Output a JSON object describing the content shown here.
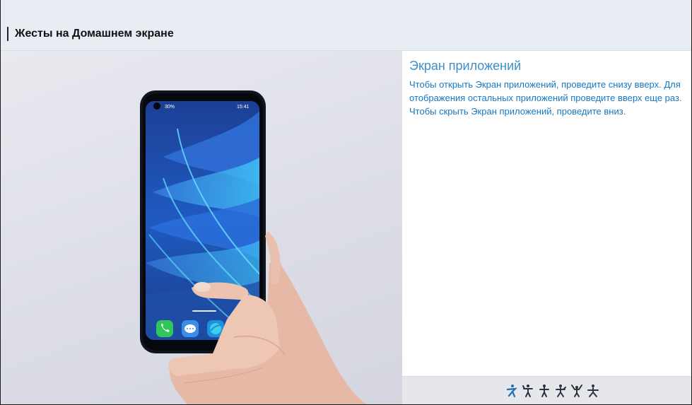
{
  "header": {
    "title": "Жесты на Домашнем экране"
  },
  "panel": {
    "title": "Экран приложений",
    "description": "Чтобы открыть Экран приложений, проведите снизу вверх. Для отображения остальных приложений проведите вверх еще раз. Чтобы скрыть Экран приложений, проведите вниз."
  },
  "phone": {
    "battery": "30%",
    "time": "15:41",
    "dock_apps": [
      "phone-app-icon",
      "messages-app-icon",
      "browser-app-icon",
      "camera-app-icon"
    ]
  },
  "gestures": {
    "active_index": 0,
    "icons": [
      "gesture-1-icon",
      "gesture-2-icon",
      "gesture-3-icon",
      "gesture-4-icon",
      "gesture-5-icon",
      "gesture-6-icon"
    ]
  },
  "colors": {
    "accent": "#1778c2",
    "title_blue": "#3d8fcb",
    "active_gesture": "#1e6fb5",
    "inactive_gesture": "#2b3340"
  }
}
